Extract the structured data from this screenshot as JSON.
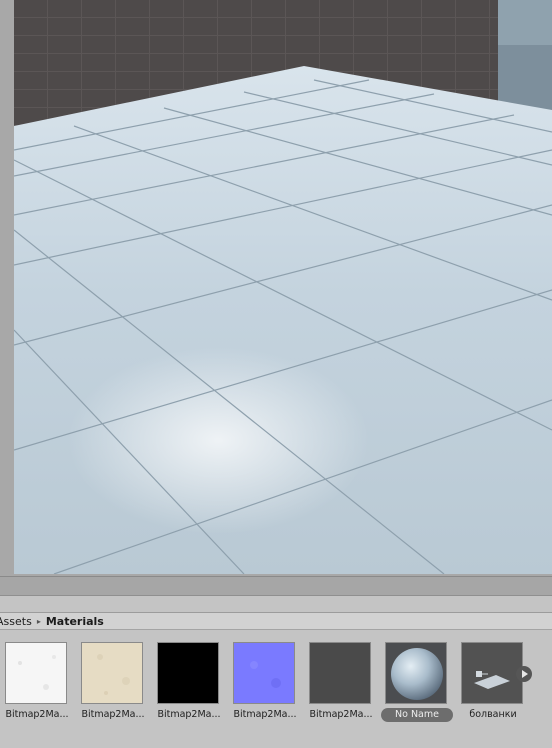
{
  "breadcrumb": {
    "root": "Assets",
    "separator": "▸",
    "current": "Materials"
  },
  "assets": [
    {
      "label": "Bitmap2Ma...",
      "icon": "white-material-thumbnail",
      "color": "#f4f4f4"
    },
    {
      "label": "Bitmap2Ma...",
      "icon": "beige-material-thumbnail",
      "color": "#e6dcc4"
    },
    {
      "label": "Bitmap2Ma...",
      "icon": "black-material-thumbnail",
      "color": "#000000"
    },
    {
      "label": "Bitmap2Ma...",
      "icon": "normal-map-thumbnail",
      "color": "#7a7aff"
    },
    {
      "label": "Bitmap2Ma...",
      "icon": "dark-gray-material-thumbnail",
      "color": "#4a4a4a"
    },
    {
      "label": "No Name",
      "icon": "sphere-material-preview",
      "selected": true
    },
    {
      "label": "болванки",
      "icon": "prefab-icon"
    }
  ],
  "colors": {
    "sky": "#4e4a4a",
    "floor": "#c7d6e0",
    "selection": "#6d6d6d"
  }
}
